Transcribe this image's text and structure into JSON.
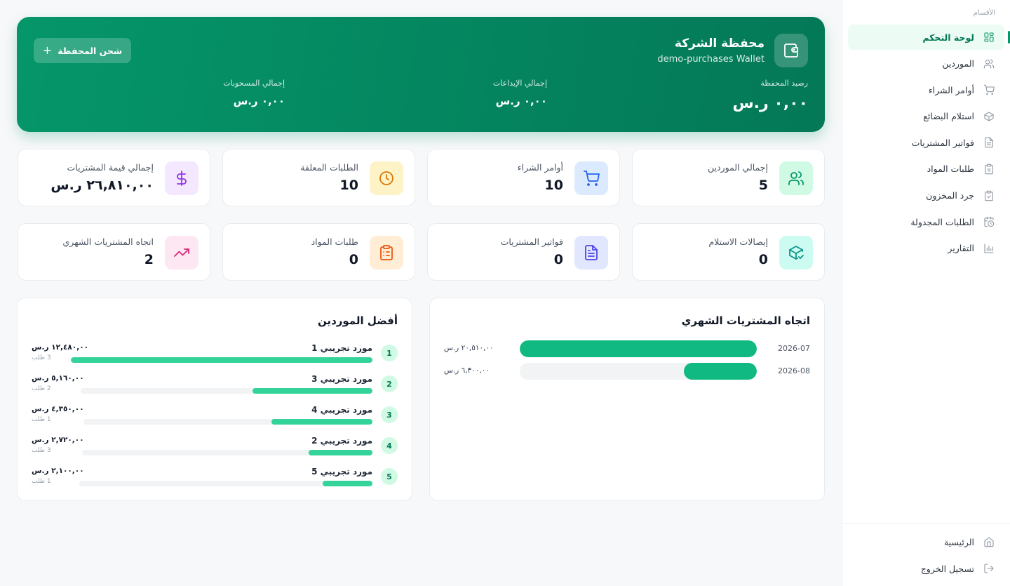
{
  "sidebar": {
    "section_label": "الأقسام",
    "items": [
      {
        "label": "لوحة التحكم",
        "icon": "dashboard-icon",
        "active": true
      },
      {
        "label": "الموردين",
        "icon": "users-icon"
      },
      {
        "label": "أوامر الشراء",
        "icon": "cart-icon"
      },
      {
        "label": "استلام البضائع",
        "icon": "package-icon"
      },
      {
        "label": "فواتير المشتريات",
        "icon": "invoice-icon"
      },
      {
        "label": "طلبات المواد",
        "icon": "clipboard-icon"
      },
      {
        "label": "جرد المخزون",
        "icon": "clipboard-check-icon"
      },
      {
        "label": "الطلبات المجدولة",
        "icon": "calendar-clock-icon"
      },
      {
        "label": "التقارير",
        "icon": "bar-chart-icon"
      }
    ],
    "footer": [
      {
        "label": "الرئيسية",
        "icon": "home-icon"
      },
      {
        "label": "تسجيل الخروج",
        "icon": "logout-icon"
      }
    ]
  },
  "wallet": {
    "title": "محفظة الشركة",
    "subtitle": "demo-purchases Wallet",
    "charge_button": "شحن المحفظة",
    "balance_label": "رصيد المحفظة",
    "balance_value": "٠,٠٠ ر.س",
    "deposits_label": "إجمالي الإيداعات",
    "deposits_value": "٠,٠٠ ر.س",
    "withdrawals_label": "إجمالي المسحوبات",
    "withdrawals_value": "٠,٠٠ ر.س"
  },
  "stats_row1": [
    {
      "label": "إجمالي الموردين",
      "value": "5",
      "icon": "users-icon",
      "bg": "#d1fae5",
      "fg": "#059669"
    },
    {
      "label": "أوامر الشراء",
      "value": "10",
      "icon": "cart-icon",
      "bg": "#dbeafe",
      "fg": "#2563eb"
    },
    {
      "label": "الطلبات المعلقة",
      "value": "10",
      "icon": "clock-icon",
      "bg": "#fef3c7",
      "fg": "#d97706"
    },
    {
      "label": "إجمالي قيمة المشتريات",
      "value": "٢٦,٨١٠,٠٠ ر.س",
      "icon": "dollar-icon",
      "bg": "#f3e8ff",
      "fg": "#9333ea"
    }
  ],
  "stats_row2": [
    {
      "label": "إيصالات الاستلام",
      "value": "0",
      "icon": "package-check-icon",
      "bg": "#ccfbf1",
      "fg": "#0d9488"
    },
    {
      "label": "فواتير المشتريات",
      "value": "0",
      "icon": "file-text-icon",
      "bg": "#e0e7ff",
      "fg": "#4f46e5"
    },
    {
      "label": "طلبات المواد",
      "value": "0",
      "icon": "clipboard-list-icon",
      "bg": "#ffedd5",
      "fg": "#ea580c"
    },
    {
      "label": "اتجاه المشتريات الشهري",
      "value": "2",
      "icon": "trending-up-icon",
      "bg": "#fce7f3",
      "fg": "#db2777"
    }
  ],
  "trend": {
    "title": "اتجاه المشتريات الشهري",
    "rows": [
      {
        "date": "2026-07",
        "amount": "٢٠,٥١٠,٠٠ ر.س",
        "value": 20510
      },
      {
        "date": "2026-08",
        "amount": "٦,٣٠٠,٠٠ ر.س",
        "value": 6300
      }
    ],
    "max": 20510
  },
  "suppliers": {
    "title": "أفضل الموردين",
    "rows": [
      {
        "rank": "1",
        "name": "مورد تجريبي 1",
        "amount": "١٢,٤٨٠,٠٠ ر.س",
        "count": "3 طلب",
        "share": 1.0
      },
      {
        "rank": "2",
        "name": "مورد تجريبي 3",
        "amount": "٥,١٦٠,٠٠ ر.س",
        "count": "2 طلب",
        "share": 0.41
      },
      {
        "rank": "3",
        "name": "مورد تجريبي 4",
        "amount": "٤,٣٥٠,٠٠ ر.س",
        "count": "1 طلب",
        "share": 0.35
      },
      {
        "rank": "4",
        "name": "مورد تجريبي 2",
        "amount": "٢,٧٢٠,٠٠ ر.س",
        "count": "3 طلب",
        "share": 0.22
      },
      {
        "rank": "5",
        "name": "مورد تجريبي 5",
        "amount": "٢,١٠٠,٠٠ ر.س",
        "count": "1 طلب",
        "share": 0.17
      }
    ]
  }
}
